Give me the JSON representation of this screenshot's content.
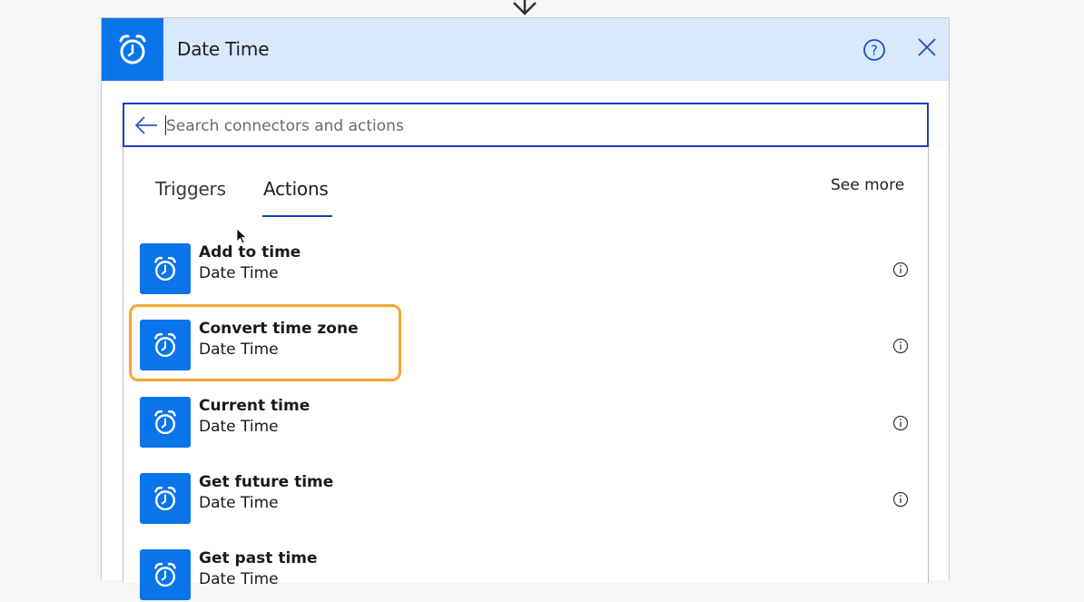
{
  "connector": {
    "title": "Date Time",
    "icon": "alarm-clock-icon",
    "brand_color": "#0a74ea",
    "header_bg": "#d7e9fb"
  },
  "header_actions": {
    "help_icon": "help-circle-icon",
    "close_icon": "close-icon"
  },
  "search": {
    "placeholder": "Search connectors and actions",
    "value": "",
    "back_icon": "back-arrow-icon"
  },
  "tabs": [
    {
      "label": "Triggers",
      "active": false
    },
    {
      "label": "Actions",
      "active": true
    }
  ],
  "see_more_label": "See more",
  "actions": [
    {
      "title": "Add to time",
      "subtitle": "Date Time",
      "highlighted": false
    },
    {
      "title": "Convert time zone",
      "subtitle": "Date Time",
      "highlighted": true
    },
    {
      "title": "Current time",
      "subtitle": "Date Time",
      "highlighted": false
    },
    {
      "title": "Get future time",
      "subtitle": "Date Time",
      "highlighted": false
    },
    {
      "title": "Get past time",
      "subtitle": "Date Time",
      "highlighted": false
    }
  ],
  "highlight_color": "#f9a431",
  "accent_color": "#1a3cc2"
}
